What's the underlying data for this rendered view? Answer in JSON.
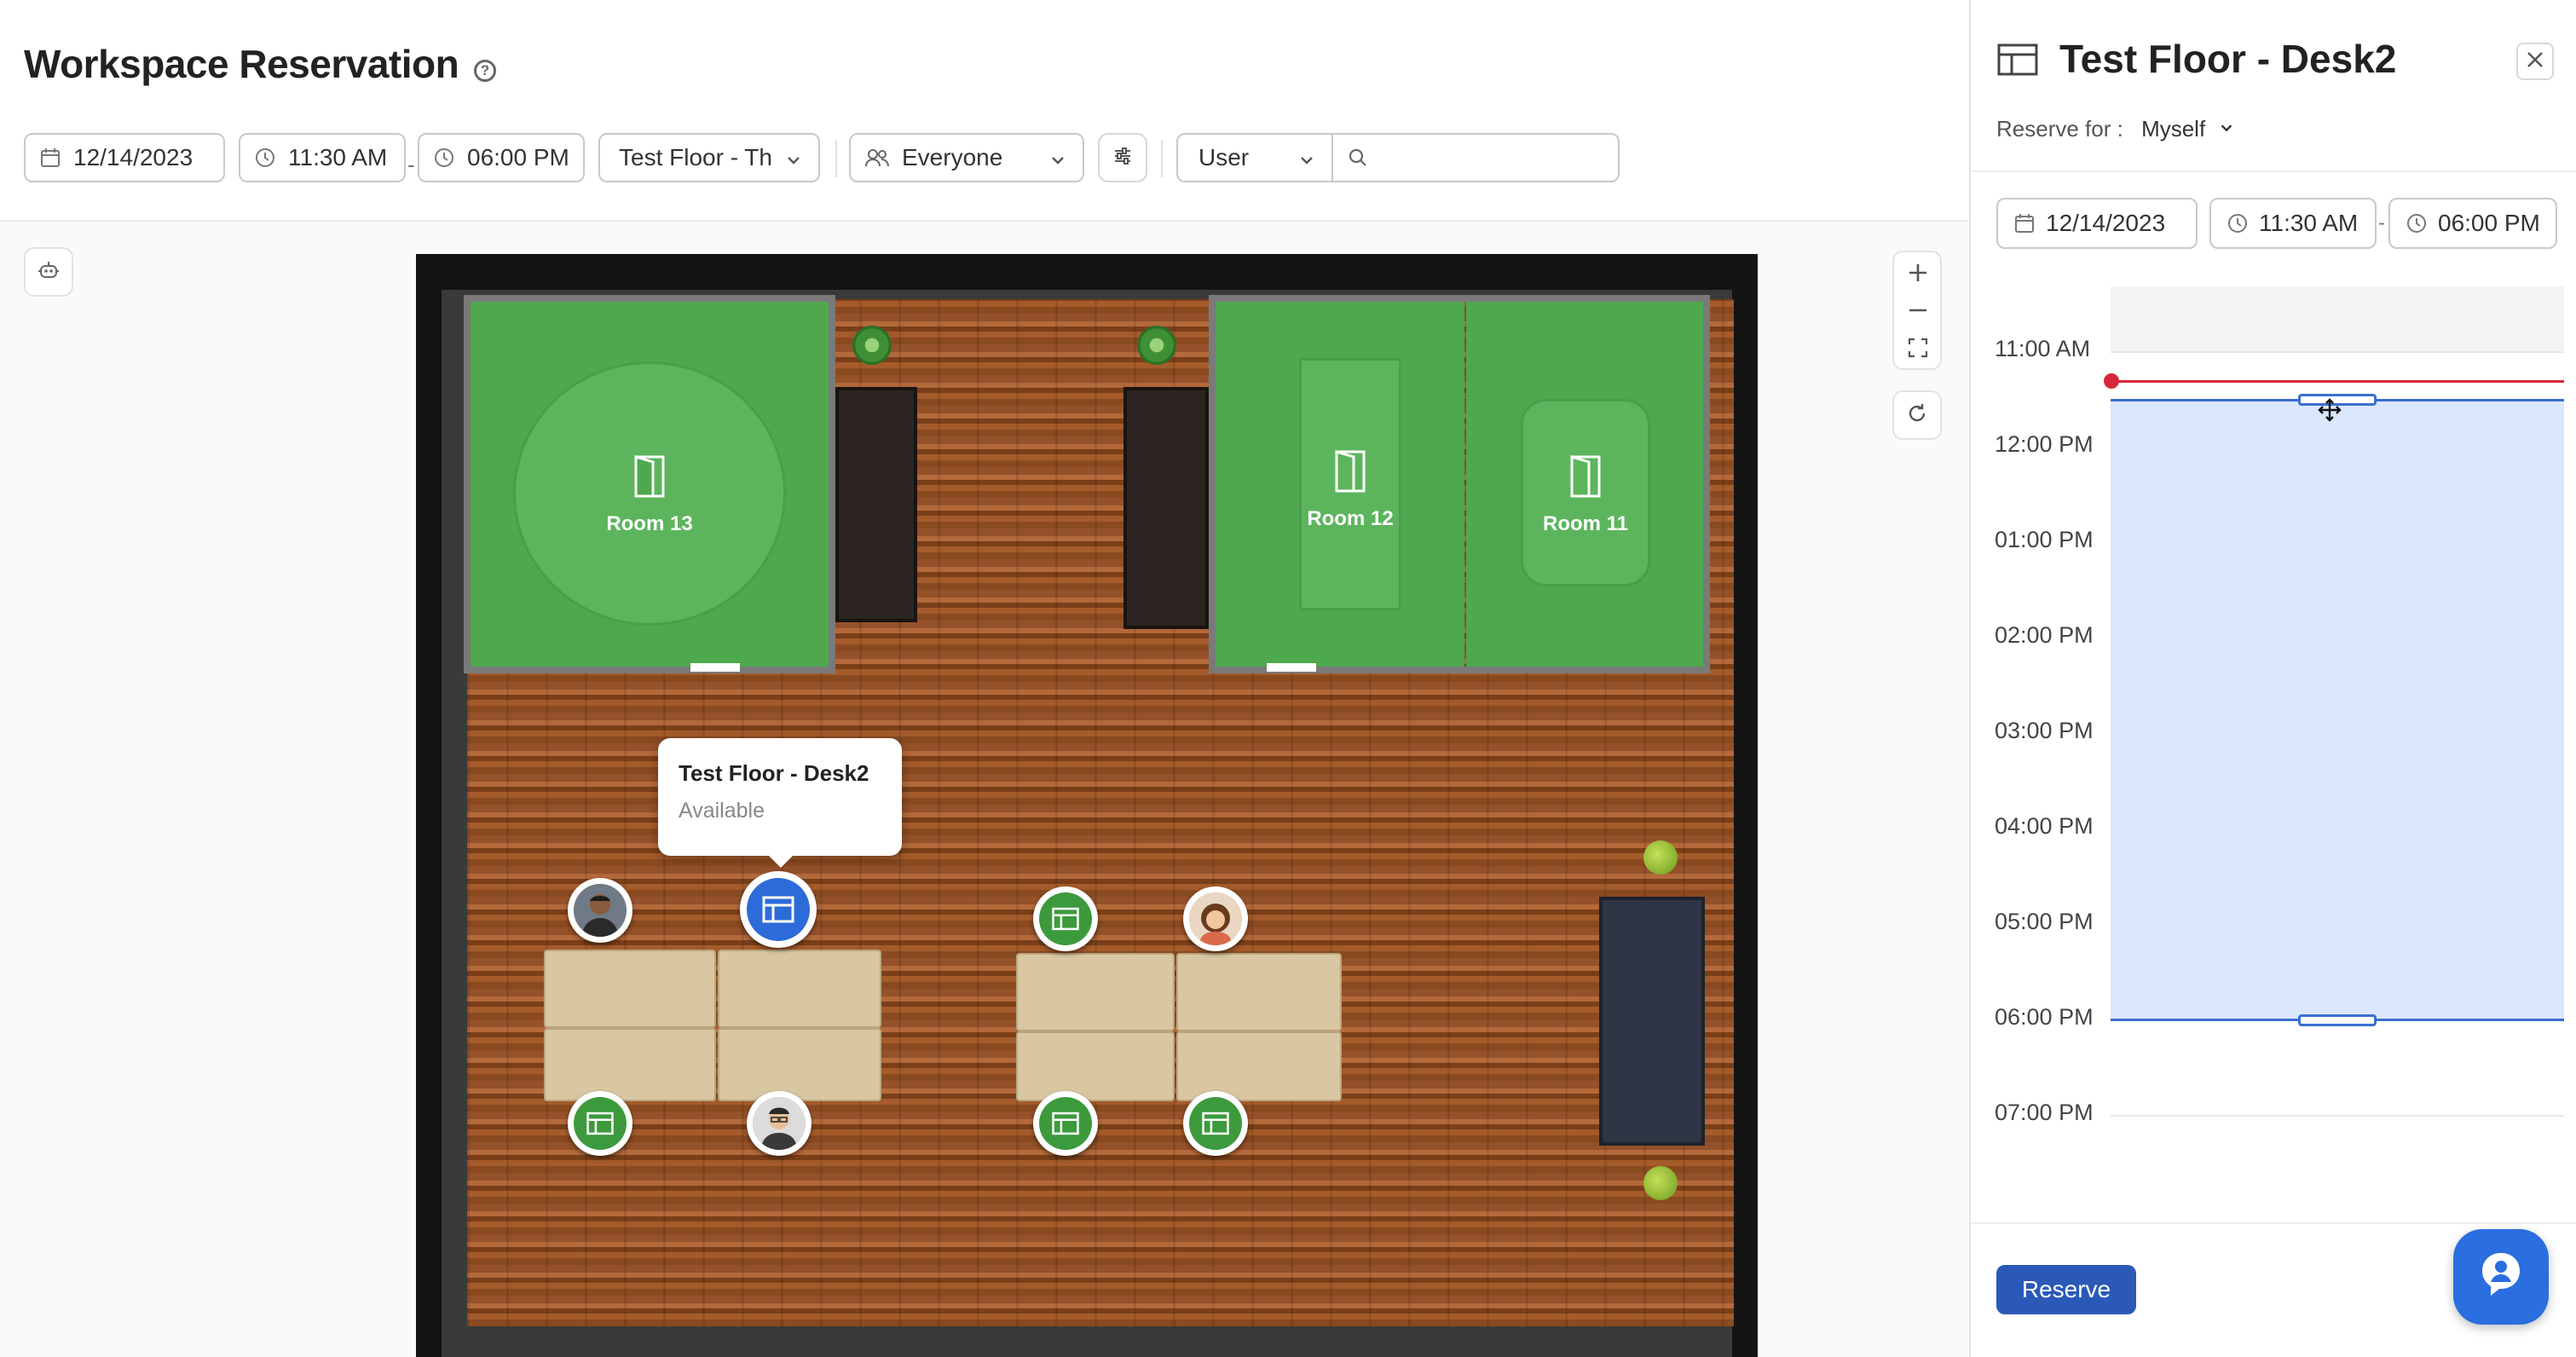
{
  "page": {
    "title": "Workspace Reservation"
  },
  "filters": {
    "date": "12/14/2023",
    "start_time": "11:30 AM",
    "end_time": "06:00 PM",
    "separator": "-",
    "floor": "Test Floor - Th",
    "audience": "Everyone",
    "search_type": "User",
    "search_value": ""
  },
  "map": {
    "rooms": [
      {
        "label": "Room 13"
      },
      {
        "label": "Room 12"
      },
      {
        "label": "Room 11"
      }
    ],
    "tooltip": {
      "title": "Test Floor - Desk2",
      "status": "Available"
    }
  },
  "panel": {
    "title": "Test Floor - Desk2",
    "reserve_for_label": "Reserve for :",
    "reserve_for_value": "Myself",
    "date": "12/14/2023",
    "start_time": "11:30 AM",
    "end_time": "06:00 PM",
    "separator": "-",
    "hours": [
      "11:00 AM",
      "12:00 PM",
      "01:00 PM",
      "02:00 PM",
      "03:00 PM",
      "04:00 PM",
      "05:00 PM",
      "06:00 PM",
      "07:00 PM"
    ],
    "reserve_label": "Reserve"
  },
  "colors": {
    "accent": "#2b59b8",
    "available": "#3c9a3c",
    "selected": "#2d6bd8",
    "now_line": "#d6283a",
    "selection_fill": "#dbe7fb"
  }
}
